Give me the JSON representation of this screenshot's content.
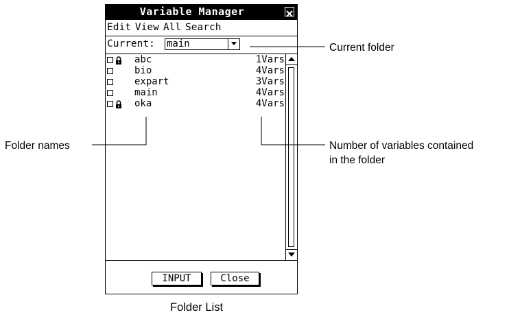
{
  "window": {
    "title": "Variable Manager"
  },
  "menu": [
    "Edit",
    "View",
    "All",
    "Search"
  ],
  "current": {
    "label": "Current:",
    "value": "main"
  },
  "folders": [
    {
      "name": "abc",
      "vars": "1Vars",
      "locked": true
    },
    {
      "name": "bio",
      "vars": "4Vars",
      "locked": false
    },
    {
      "name": "expart",
      "vars": "3Vars",
      "locked": false
    },
    {
      "name": "main",
      "vars": "4Vars",
      "locked": false
    },
    {
      "name": "oka",
      "vars": "4Vars",
      "locked": true
    }
  ],
  "buttons": {
    "input": "INPUT",
    "close": "Close"
  },
  "annotations": {
    "current_folder": "Current folder",
    "folder_names": "Folder names",
    "num_vars_line1": "Number of variables contained",
    "num_vars_line2": "in the folder",
    "caption": "Folder List"
  },
  "icons": {
    "close": "close-icon",
    "dropdown": "triangle-down-icon",
    "lock": "lock-icon",
    "scroll_up": "triangle-up-icon",
    "scroll_down": "triangle-down-icon"
  }
}
